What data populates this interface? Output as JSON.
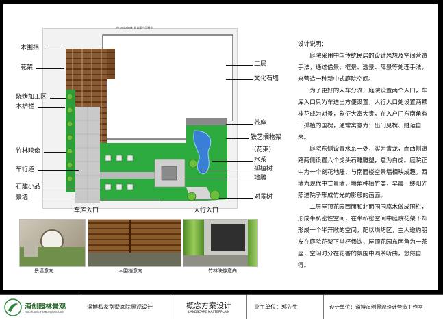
{
  "plan": {
    "header": "由 Autodesk 教育版产品制作",
    "labels": {
      "fence": "木围挡",
      "pergola": "花架",
      "bbq": "烧烤加工区",
      "guard": "木护栏",
      "bamboo": "竹林映像",
      "drive": "车行道",
      "stone": "石雕小品",
      "wall": "景墙",
      "garage": "车库入口",
      "second": "二层",
      "culture_wall": "文化石墙",
      "tea": "茶座",
      "iron": "铁艺搁物架",
      "flower_rack": "(花架)",
      "water": "水系",
      "tree": "孤植树",
      "sculpture": "地雕",
      "entry": "人行入口",
      "pair_tree": "对景树"
    }
  },
  "notes": [
    "设计说明：",
    "庭院采用中国传统民居的设计思想及空间营造手法，通过借景、框景、透景、障景等处理手法，来营造一种新中式庭院空间。",
    "为了更好的人车分流，庭院设置两个入口，车库入口只为车进出方便设置，人行入口处设置两颗桂花成为对景，象征大富大贵，在入户门东南角有一孤植的国槐，通常寓意为：出门见槐、财运自来。",
    "庭院东侧设置水系一处，实为青龙，而西侧道路两侧设置六个虎头石雕雕塑，意为白虎。庭院正中为一个刻花地雕，与南面楼空景墙相映成趣。西墙为现代中式景墙，墙角种植竹类，早晨一缕阳光照进院子形成竹光的影般的画面。",
    "二层屋顶花园西面和北面围围腐木做成围栏，形成半私密性空间，在半私密空间中庭院花架下却形成一个半开敞的空间，配以烧烤区，主人邀约朋友在庭院花架下举杯畅饮，屋顶花园东南角为一茶座，空闲时分在花香的氛围中喝茶听曲，悠然自得。"
  ],
  "photos": {
    "wall_caption": "景墙意向",
    "fence_caption": "木围挡意向",
    "bamboo_caption": "竹林映像意向"
  },
  "footer": {
    "logo_text": "海创园林景观",
    "logo_sub": "HAICHUANG YUANLIN JINGGUAN",
    "project": "淄博私家别墅庭院景观设计",
    "title": "概念方案设计",
    "title_en": "LANDSCAPE MASTERPLAIN",
    "owner": "业主单位：郭先生",
    "designer": "设计单位：淄博海创景观设计营造工作室"
  },
  "colors": {
    "grass": "#2eab3f",
    "water": "#3a7fd6",
    "wood": "#6b3d1f",
    "paving": "#c8c8c8"
  }
}
